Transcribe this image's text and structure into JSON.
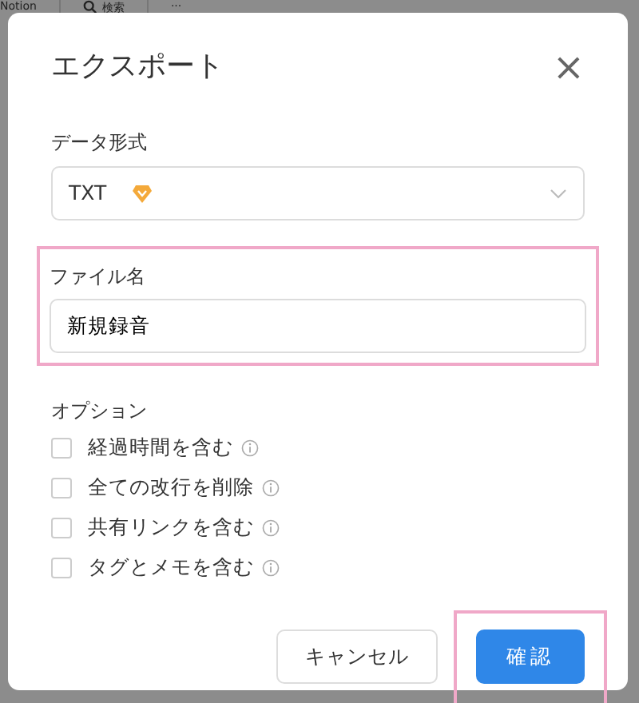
{
  "background_toolbar": [
    {
      "kind": "text",
      "label": "Notion"
    },
    {
      "kind": "search",
      "label": "検索"
    },
    {
      "kind": "text",
      "label": "···"
    }
  ],
  "dialog": {
    "title": "エクスポート",
    "close": "×",
    "format": {
      "label": "データ形式",
      "value": "TXT",
      "premium": true
    },
    "file_name": {
      "label": "ファイル名",
      "value": "新規録音",
      "highlighted": true
    },
    "options_label": "オプション",
    "options": [
      {
        "label": "経過時間を含む",
        "checked": false
      },
      {
        "label": "全ての改行を削除",
        "checked": false
      },
      {
        "label": "共有リンクを含む",
        "checked": false
      },
      {
        "label": "タグとメモを含む",
        "checked": false
      }
    ],
    "buttons": [
      {
        "kind": "secondary",
        "label": "キャンセル",
        "highlighted": false
      },
      {
        "kind": "primary",
        "label": "確認",
        "highlighted": true
      }
    ]
  }
}
